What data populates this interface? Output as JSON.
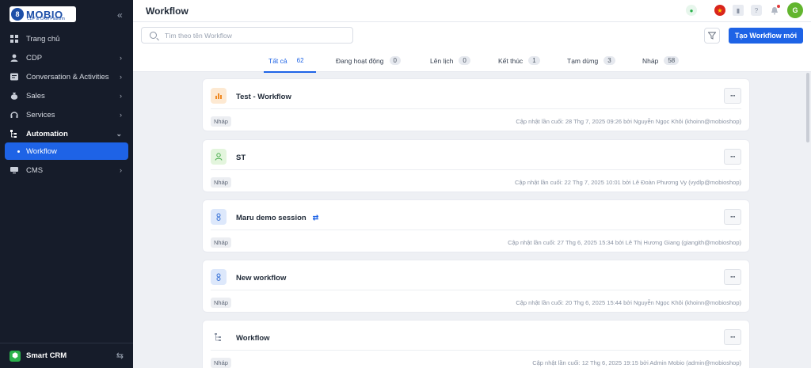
{
  "sidebar": {
    "brand": {
      "name": "MOBIO",
      "tagline": "CDP & CRM Platform"
    },
    "items": [
      {
        "label": "Trang chủ",
        "icon": "home-grid-icon"
      },
      {
        "label": "CDP",
        "icon": "user-icon"
      },
      {
        "label": "Conversation & Activities",
        "icon": "chat-icon"
      },
      {
        "label": "Sales",
        "icon": "money-bag-icon"
      },
      {
        "label": "Services",
        "icon": "support-icon"
      },
      {
        "label": "Automation",
        "icon": "flow-icon"
      },
      {
        "label": "CMS",
        "icon": "monitor-icon"
      }
    ],
    "active_sub": "Workflow",
    "footer_label": "Smart CRM"
  },
  "header": {
    "title": "Workflow",
    "avatar_initial": "G"
  },
  "toolbar": {
    "search_placeholder": "Tìm theo tên Workflow",
    "create_label": "Tạo Workflow mới"
  },
  "tabs": [
    {
      "label": "Tất cả",
      "count": "62"
    },
    {
      "label": "Đang hoạt động",
      "count": "0"
    },
    {
      "label": "Lên lịch",
      "count": "0"
    },
    {
      "label": "Kết thúc",
      "count": "1"
    },
    {
      "label": "Tạm dừng",
      "count": "3"
    },
    {
      "label": "Nháp",
      "count": "58"
    }
  ],
  "workflows": [
    {
      "name": "Test - Workflow",
      "status": "Nháp",
      "meta": "Cập nhật lần cuối: 28 Thg 7, 2025 09:26 bởi Nguyễn Ngọc Khôi (khoinn@mobioshop)",
      "icon": "chart-icon"
    },
    {
      "name": "ST",
      "status": "Nháp",
      "meta": "Cập nhật lần cuối: 22 Thg 7, 2025 10:01 bởi Lê Đoàn Phương Vy (vydlp@mobioshop)",
      "icon": "person-icon"
    },
    {
      "name": "Maru demo session",
      "status": "Nháp",
      "meta": "Cập nhật lần cuối: 27 Thg 6, 2025 15:34 bởi Lê Thị Hương Giang (giangith@mobioshop)",
      "icon": "profile-icon"
    },
    {
      "name": "New workflow",
      "status": "Nháp",
      "meta": "Cập nhật lần cuối: 20 Thg 6, 2025 15:44 bởi Nguyễn Ngọc Khôi (khoinn@mobioshop)",
      "icon": "profile-icon"
    },
    {
      "name": "Workflow",
      "status": "Nháp",
      "meta": "Cập nhật lần cuối: 12 Thg 6, 2025 19:15 bởi Admin Mobio (admin@mobioshop)",
      "icon": "flow-icon"
    }
  ],
  "colors": {
    "sidebar_bg": "#161c2a",
    "accent": "#1e63e6"
  }
}
